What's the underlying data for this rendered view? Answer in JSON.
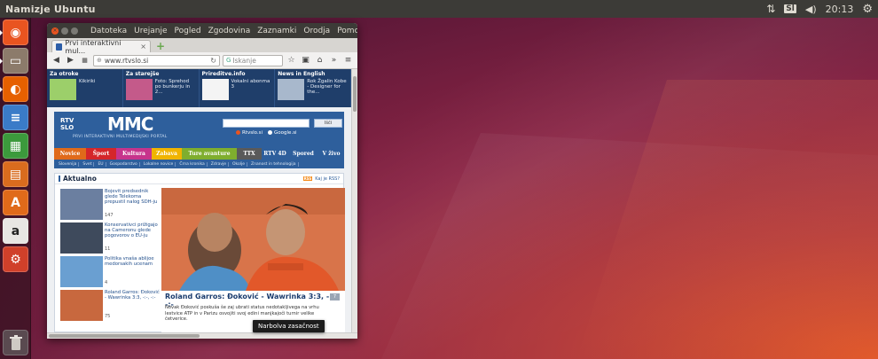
{
  "top_panel": {
    "app_title": "Namizje Ubuntu",
    "keyboard": "Sl",
    "clock": "20:13"
  },
  "launcher": {
    "items": [
      {
        "name": "dash-home",
        "glyph": "◉",
        "color": "#e95420"
      },
      {
        "name": "files",
        "glyph": "▭",
        "color": "#8c7b6b"
      },
      {
        "name": "firefox",
        "glyph": "◐",
        "color": "#e66000"
      },
      {
        "name": "writer",
        "glyph": "≡",
        "color": "#3a7bc8"
      },
      {
        "name": "calc",
        "glyph": "▦",
        "color": "#3c9a3c"
      },
      {
        "name": "impress",
        "glyph": "▤",
        "color": "#d96c1e"
      },
      {
        "name": "software-center",
        "glyph": "A",
        "color": "#e06a1a"
      },
      {
        "name": "amazon",
        "glyph": "a",
        "color": "#e8e6e3"
      },
      {
        "name": "system-settings",
        "glyph": "⚙",
        "color": "#d0402a"
      }
    ],
    "trash_glyph": "🗑"
  },
  "browser": {
    "menu": [
      "Datoteka",
      "Urejanje",
      "Pogled",
      "Zgodovina",
      "Zaznamki",
      "Orodja",
      "Pomoč"
    ],
    "tab_title": "Prvi interaktivni mul...",
    "url": "www.rtvslo.si",
    "search_placeholder": "Iskanje",
    "tooltip": "Narbolva zasačnost"
  },
  "page": {
    "promo": [
      {
        "title": "Za otroke",
        "text": "Kikiriki"
      },
      {
        "title": "Za starejše",
        "text": "Foto: Sprehod po bunkerju in 2..."
      },
      {
        "title": "Prireditve.info",
        "text": "Vokalni abonma 3"
      },
      {
        "title": "News in English",
        "text": "Rok Žgalin Kobe - Designer for the..."
      }
    ],
    "rtv_logo": "RTV SLO",
    "mmc_logo": "MMC",
    "mmc_sub": "PRVI INTERAKTIVNI MULTIMEDIJSKI PORTAL",
    "search_button": "Išči",
    "radio_options": [
      "Rtvslo.si",
      "Google.si"
    ],
    "categories": [
      {
        "label": "Novice",
        "color": "#e06a1a"
      },
      {
        "label": "Šport",
        "color": "#d4262a"
      },
      {
        "label": "Kultura",
        "color": "#c7348c"
      },
      {
        "label": "Zabava",
        "color": "#f0b400"
      },
      {
        "label": "Ture avanture",
        "color": "#7fae2e"
      },
      {
        "label": "TTX",
        "color": "#5a5a5a"
      },
      {
        "label": "RTV 4D",
        "color": "#2e5f9c"
      },
      {
        "label": "Spored",
        "color": "#2e5f9c"
      },
      {
        "label": "V živo",
        "color": "#2e5f9c"
      }
    ],
    "subnav": [
      "Slovenija",
      "Svet",
      "EU",
      "Gospodarstvo",
      "Lokalne novice",
      "Črna kronika",
      "Zdravje",
      "Okolje",
      "Znanost in tehnologija"
    ],
    "section_title": "Aktualno",
    "rss_label": "RSS",
    "rss_link": "Kaj je RSS?",
    "news": [
      {
        "text": "Bojevit predsednik glede Telekoma prepustil nalog SDH-ju",
        "count": "147",
        "thumb": "#6b7fa0"
      },
      {
        "text": "Konservativci prižigajo na Cameronu glede pogovorov o EU-ju",
        "count": "11",
        "thumb": "#3e4a5c"
      },
      {
        "text": "Politika vnaša ablijoe medorsakih ucenam",
        "count": "4",
        "thumb": "#6a9fd1"
      },
      {
        "text": "Roland Garros: Đoković - Wawrinka 3:3, -:-, -:-",
        "count": "75",
        "thumb": "#c8683e"
      }
    ],
    "hero_headline": "Roland Garros: Đoković - Wawrinka 3:3, -:-, -:-",
    "hero_text": "Novak Đoković poskuša še zaj ubrati status nedotakljivega na vrhu lestvice ATP in v Parizu osvojiti svoj edini manjkajoči turnir velike četverice.",
    "hero_comments": "7"
  }
}
